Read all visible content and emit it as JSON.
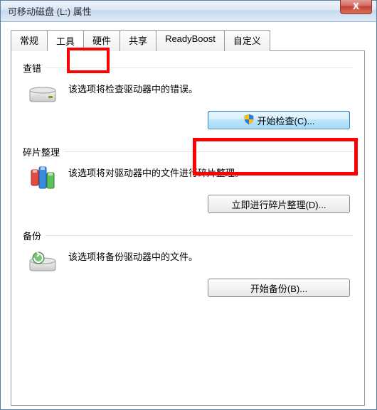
{
  "window": {
    "title": "可移动磁盘 (L:) 属性",
    "close_label": "X"
  },
  "tabs": {
    "general": "常规",
    "tools": "工具",
    "hardware": "硬件",
    "sharing": "共享",
    "readyboost": "ReadyBoost",
    "custom": "自定义"
  },
  "sections": {
    "check": {
      "title": "查错",
      "desc": "该选项将检查驱动器中的错误。",
      "button": "开始检查(C)..."
    },
    "defrag": {
      "title": "碎片整理",
      "desc": "该选项将对驱动器中的文件进行碎片整理。",
      "button": "立即进行碎片整理(D)..."
    },
    "backup": {
      "title": "备份",
      "desc": "该选项将备份驱动器中的文件。",
      "button": "开始备份(B)..."
    }
  }
}
